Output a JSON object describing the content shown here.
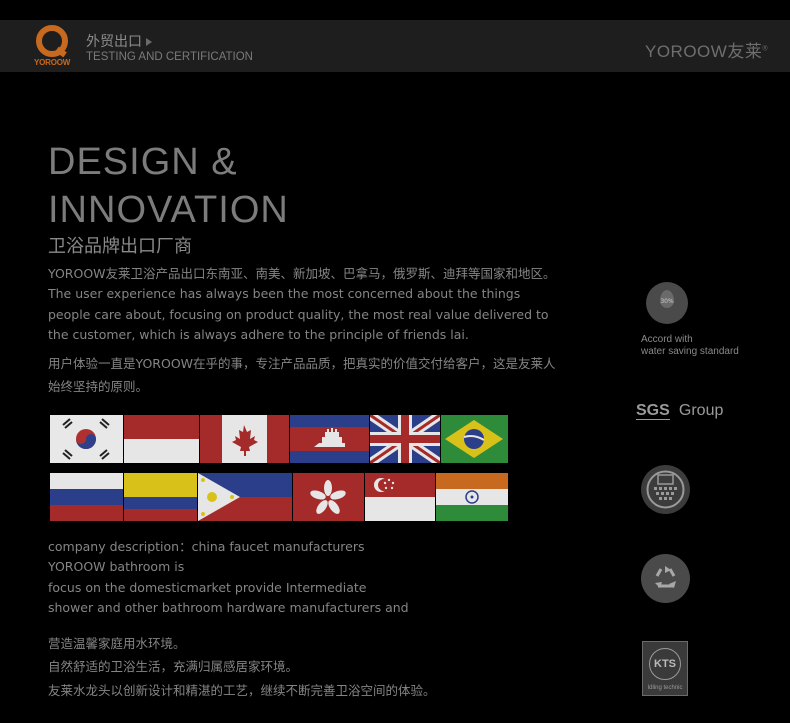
{
  "header": {
    "logo_text": "YOROOW",
    "title": "外贸出口",
    "subtitle": "TESTING AND CERTIFICATION",
    "brand": "YOROOW友莱",
    "brand_mark": "®"
  },
  "main": {
    "heading": "DESIGN & INNOVATION",
    "subheading": "卫浴品牌出口厂商",
    "intro_cn": "YOROOW友莱卫浴产品出口东南亚、南美、新加坡、巴拿马，俄罗斯、迪拜等国家和地区。",
    "intro_en_1": "The user experience has always been the most concerned about the things",
    "intro_en_2": "people care about, focusing on product quality, the most real value delivered to",
    "intro_en_3": "the customer, which is always adhere to the principle of friends lai.",
    "user_cn_1": "用户体验一直是YOROOW在乎的事，专注产品品质，把真实的价值交付给客户，这是友莱人",
    "user_cn_2": "始终坚持的原则。",
    "company_1": "company description：china faucet manufacturers",
    "company_2": " YOROOW bathroom is",
    "company_3": "focus on the domesticmarket provide Intermediate",
    "company_4": "shower and other bathroom hardware manufacturers and",
    "closing_1": "营造温馨家庭用水环境。",
    "closing_2": "自然舒适的卫浴生活，充满归属感居家环境。",
    "closing_3": "友莱水龙头以创新设计和精湛的工艺，继续不断完善卫浴空间的体验。"
  },
  "flags": [
    "south-korea",
    "indonesia",
    "canada",
    "cambodia",
    "united-kingdom",
    "brazil",
    "russia",
    "colombia",
    "philippines",
    "hong-kong",
    "singapore",
    "india"
  ],
  "sidebar": {
    "water_badge": "30%",
    "water_text_1": "Accord with",
    "water_text_2": "water saving standard",
    "sgs_logo": "SGS",
    "sgs_text": "Group",
    "kts_logo": "KTS",
    "kts_caption": "Idling technic"
  },
  "colors": {
    "accent": "#c76a1f",
    "background": "#000000",
    "bar": "#1e1e1e"
  }
}
